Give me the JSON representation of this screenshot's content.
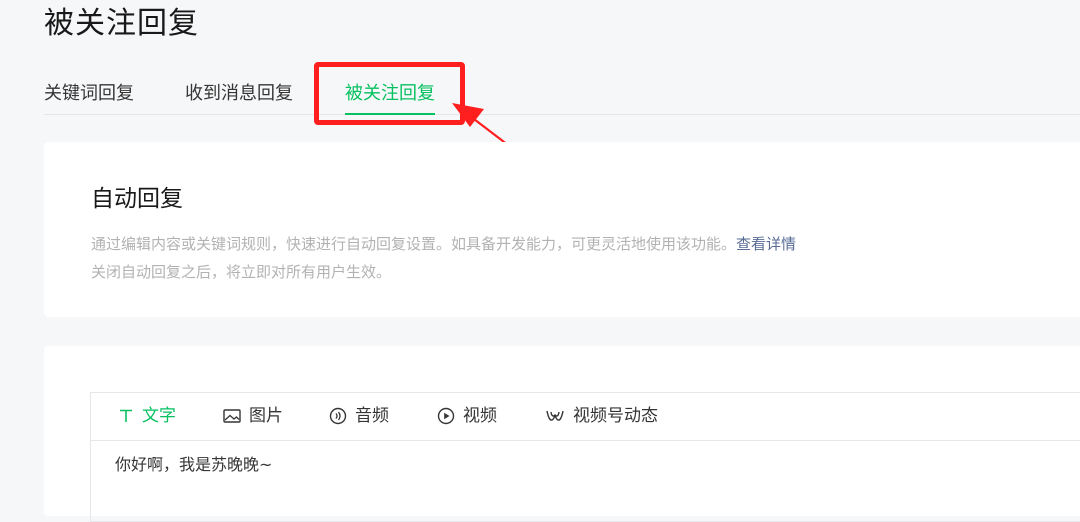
{
  "page": {
    "title": "被关注回复"
  },
  "tabs": [
    {
      "label": "关键词回复"
    },
    {
      "label": "收到消息回复"
    },
    {
      "label": "被关注回复"
    }
  ],
  "intro_card": {
    "title": "自动回复",
    "desc_line1": "通过编辑内容或关键词规则，快速进行自动回复设置。如具备开发能力，可更灵活地使用该功能。",
    "link_text": "查看详情",
    "desc_line2": "关闭自动回复之后，将立即对所有用户生效。"
  },
  "editor": {
    "tools": [
      {
        "label": "文字",
        "icon": "text-icon"
      },
      {
        "label": "图片",
        "icon": "image-icon"
      },
      {
        "label": "音频",
        "icon": "audio-icon"
      },
      {
        "label": "视频",
        "icon": "video-icon"
      },
      {
        "label": "视频号动态",
        "icon": "channels-icon"
      }
    ],
    "content": "你好啊，我是苏晚晚~"
  },
  "colors": {
    "accent": "#07c160",
    "link": "#576b95",
    "annotation": "#ff1f1f",
    "muted_text": "#b2b2b2"
  }
}
